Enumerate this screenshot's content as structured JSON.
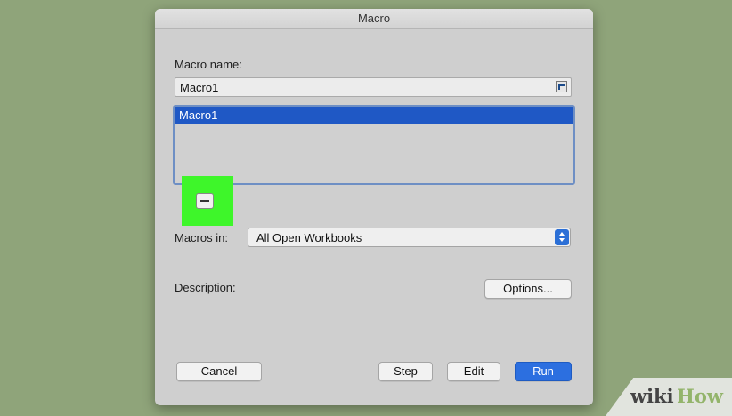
{
  "dialog": {
    "title": "Macro",
    "macro_name_label": "Macro name:",
    "macro_name_value": "Macro1",
    "macro_list": [
      "Macro1"
    ],
    "macros_in_label": "Macros in:",
    "macros_in_value": "All Open Workbooks",
    "description_label": "Description:",
    "buttons": {
      "options": "Options...",
      "cancel": "Cancel",
      "step": "Step",
      "edit": "Edit",
      "run": "Run"
    }
  },
  "watermark": {
    "part1": "wiki",
    "part2": "How"
  },
  "colors": {
    "background": "#8fa47a",
    "dialog": "#cfcfcf",
    "selection": "#1f58c5",
    "highlight": "#3ef62a",
    "primary_button": "#2c6fe0"
  },
  "icons": [
    "collapse-dialog-icon",
    "remove-macro-icon",
    "dropdown-stepper-icon"
  ]
}
